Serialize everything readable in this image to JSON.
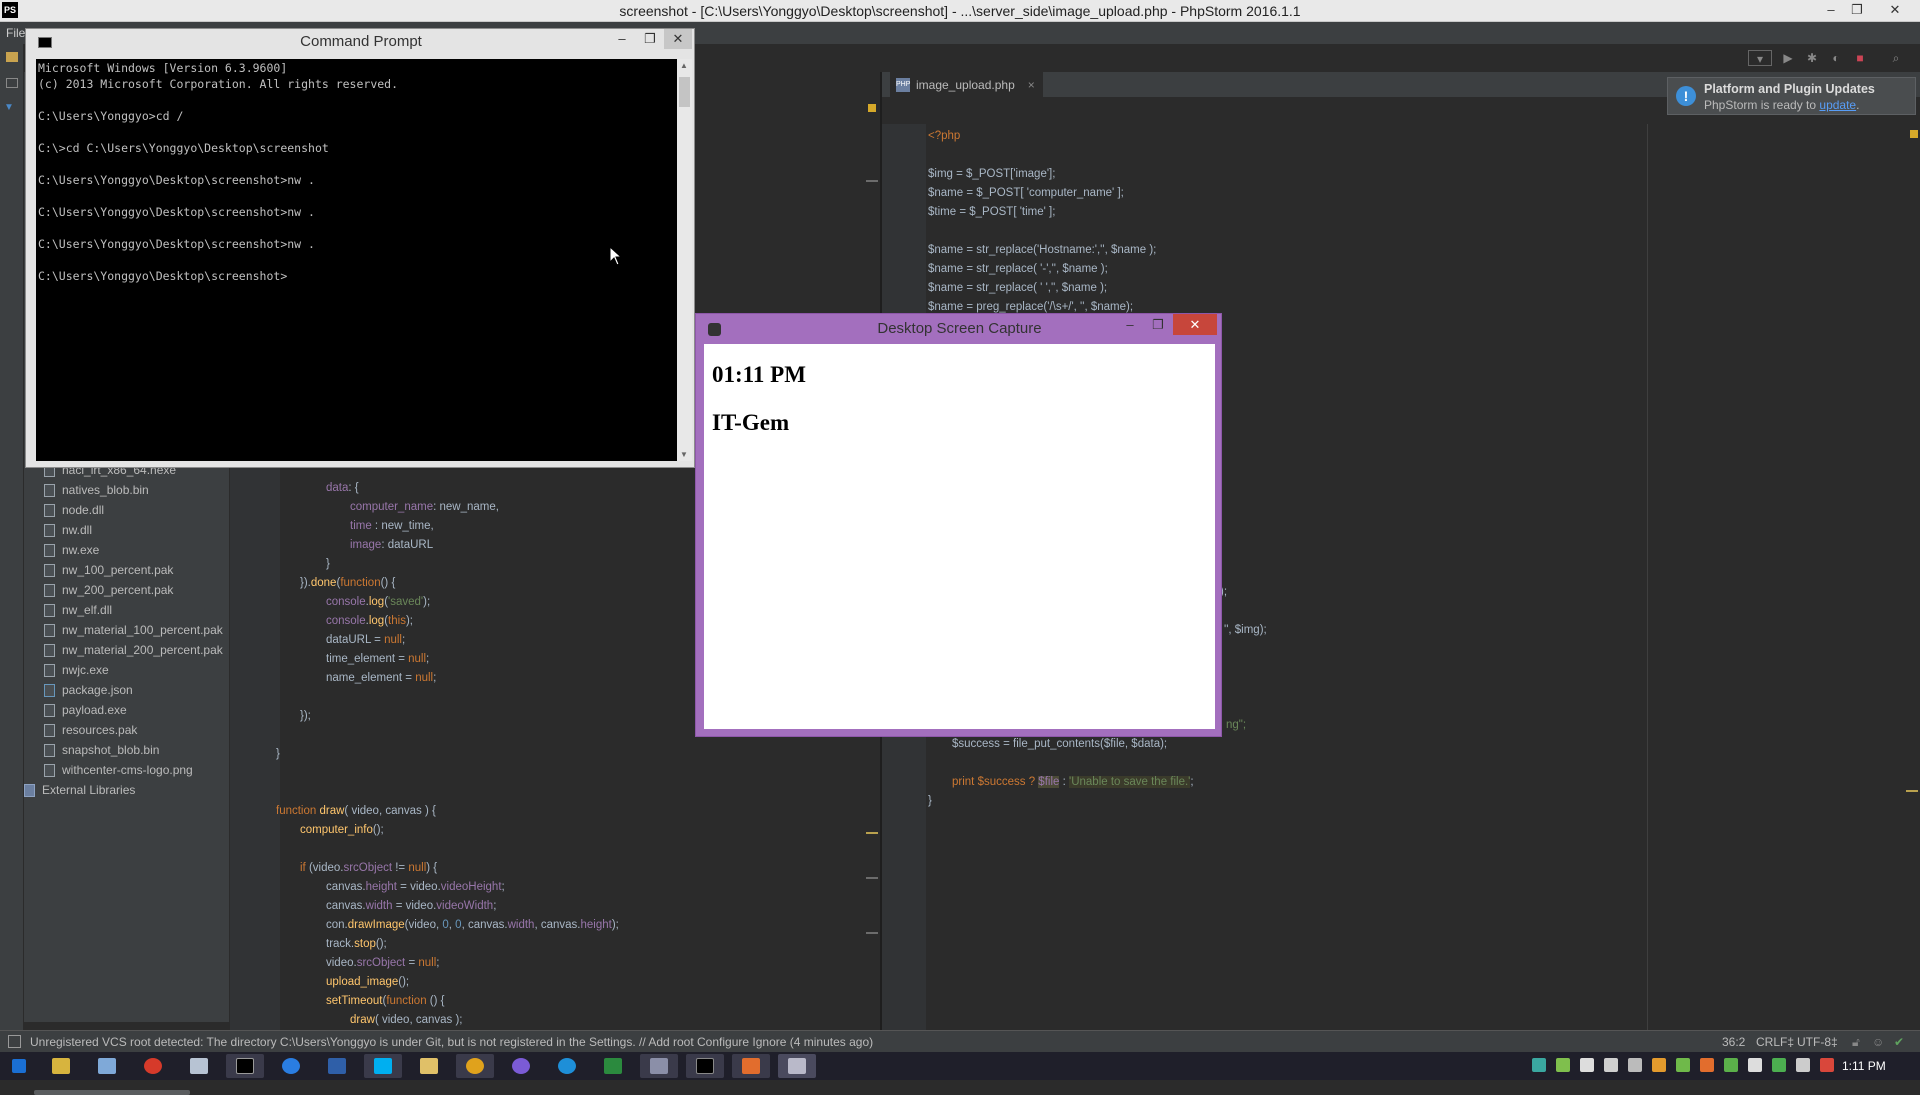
{
  "window": {
    "title": "screenshot - [C:\\Users\\Yonggyo\\Desktop\\screenshot] - ...\\server_side\\image_upload.php - PhpStorm 2016.1.1",
    "logo_text": "PS",
    "minimize": "–",
    "maximize": "❐",
    "close": "✕"
  },
  "menu": {
    "file": "File"
  },
  "project_tree": {
    "items": [
      "nacl_irt_x86_64.nexe",
      "natives_blob.bin",
      "node.dll",
      "nw.dll",
      "nw.exe",
      "nw_100_percent.pak",
      "nw_200_percent.pak",
      "nw_elf.dll",
      "nw_material_100_percent.pak",
      "nw_material_200_percent.pak",
      "nwjc.exe",
      "package.json",
      "payload.exe",
      "resources.pak",
      "snapshot_blob.bin",
      "withcenter-cms-logo.png"
    ],
    "external": "External Libraries"
  },
  "editor_js": {
    "lines": [
      "data: {",
      "    computer_name: new_name,",
      "    time : new_time,",
      "    image: dataURL",
      "}",
      "}).done(function() {",
      "    console.log('saved');",
      "    console.log(this);",
      "    dataURL = null;",
      "    time_element = null;",
      "    name_element = null;",
      "",
      "});",
      "",
      "}",
      "",
      "",
      "function draw( video, canvas ) {",
      "    computer_info();",
      "",
      "    if (video.srcObject != null) {",
      "        canvas.height = video.videoHeight;",
      "        canvas.width = video.videoWidth;",
      "        con.drawImage(video, 0, 0, canvas.width, canvas.height);",
      "        track.stop();",
      "        video.srcObject = null;",
      "        upload_image();",
      "        setTimeout(function () {",
      "            draw( video, canvas );"
    ]
  },
  "tab": {
    "label": "image_upload.php",
    "close": "×"
  },
  "editor_php": {
    "open_tag": "<?php",
    "lines": [
      "$img = $_POST['image'];",
      "$name = $_POST[ 'computer_name' ];",
      "$time = $_POST[ 'time' ];",
      "",
      "$name = str_replace('Hostname:','', $name );",
      "$name = str_replace( '-','', $name );",
      "$name = str_replace( ' ','', $name );",
      "$name = preg_replace('/\\s+/', '', $name);"
    ],
    "frag1": ");",
    "frag2": "'', $img);",
    "frag3": "ng\";",
    "success_line": "$success = file_put_contents($file, $data);",
    "print_prefix": "print $success ? ",
    "print_var": "$file",
    "print_mid": " : ",
    "print_str": "'Unable to save the file.'",
    "print_end": ";",
    "closing": "}"
  },
  "notification": {
    "title": "Platform and Plugin Updates",
    "body": "PhpStorm is ready to ",
    "link": "update",
    "period": "."
  },
  "cmd": {
    "title": "Command Prompt",
    "lines": [
      "Microsoft Windows [Version 6.3.9600]",
      "(c) 2013 Microsoft Corporation. All rights reserved.",
      "",
      "C:\\Users\\Yonggyo>cd /",
      "",
      "C:\\>cd C:\\Users\\Yonggyo\\Desktop\\screenshot",
      "",
      "C:\\Users\\Yonggyo\\Desktop\\screenshot>nw .",
      "",
      "C:\\Users\\Yonggyo\\Desktop\\screenshot>nw .",
      "",
      "C:\\Users\\Yonggyo\\Desktop\\screenshot>nw .",
      "",
      "C:\\Users\\Yonggyo\\Desktop\\screenshot>"
    ]
  },
  "capture": {
    "title": "Desktop Screen Capture",
    "time": "01:11 PM",
    "host": "IT-Gem"
  },
  "status": {
    "message": "Unregistered VCS root detected: The directory C:\\Users\\Yonggyo is under Git, but is not registered in the Settings. // Add root  Configure  Ignore (4 minutes ago)",
    "position": "36:2",
    "line_sep": "CRLF‡",
    "encoding": "UTF-8‡"
  },
  "taskbar": {
    "clock": "1:11 PM"
  }
}
